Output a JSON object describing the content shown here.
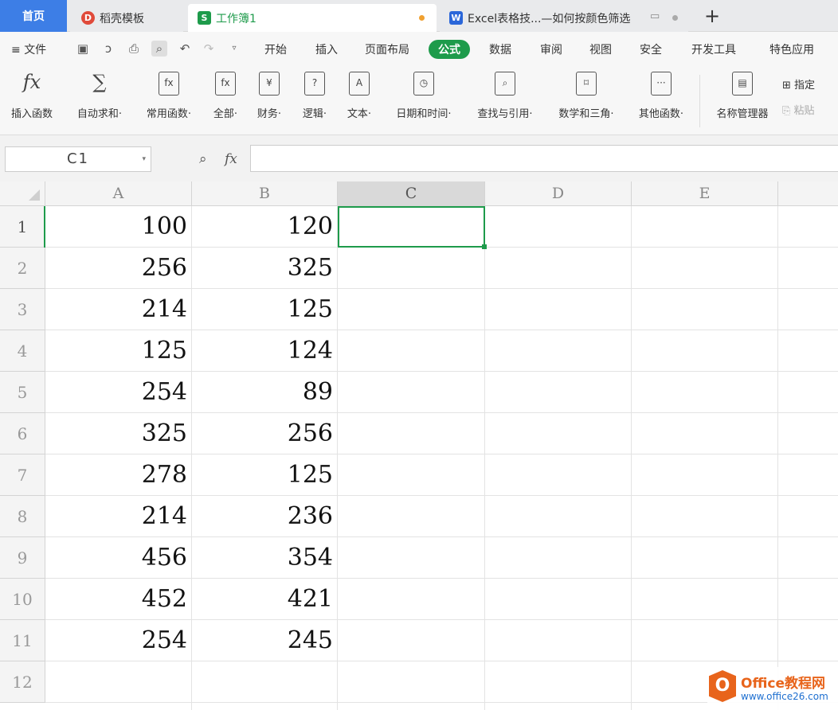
{
  "tabs": [
    {
      "label": "首页"
    },
    {
      "label": "稻壳模板"
    },
    {
      "label": "工作簿1"
    },
    {
      "label": "Excel表格技...—如何按颜色筛选"
    }
  ],
  "quick_icons": [
    "save-icon",
    "format-painter-icon",
    "print-icon",
    "print-preview-icon",
    "undo-icon",
    "redo-icon",
    "customize-arrow-icon"
  ],
  "menu": {
    "file": "文件",
    "items": [
      "开始",
      "插入",
      "页面布局",
      "公式",
      "数据",
      "审阅",
      "视图",
      "安全",
      "开发工具",
      "特色应用"
    ],
    "active": "公式"
  },
  "ribbon": {
    "buttons": [
      {
        "label": "插入函数",
        "glyph": "fx"
      },
      {
        "label": "自动求和·",
        "glyph": "∑"
      },
      {
        "label": "常用函数·",
        "glyph": "fx"
      },
      {
        "label": "全部·",
        "glyph": "fx"
      },
      {
        "label": "财务·",
        "glyph": "¥"
      },
      {
        "label": "逻辑·",
        "glyph": "?"
      },
      {
        "label": "文本·",
        "glyph": "A"
      },
      {
        "label": "日期和时间·",
        "glyph": "◷"
      },
      {
        "label": "查找与引用·",
        "glyph": "⌕"
      },
      {
        "label": "数学和三角·",
        "glyph": "⌑"
      },
      {
        "label": "其他函数·",
        "glyph": "···"
      },
      {
        "label": "名称管理器",
        "glyph": "▤"
      }
    ],
    "side": {
      "pin": "指定",
      "paste": "粘贴"
    }
  },
  "formula_bar": {
    "name_box": "C1",
    "fx": "fx",
    "value": ""
  },
  "sheet": {
    "columns": [
      "A",
      "B",
      "C",
      "D",
      "E"
    ],
    "selected_column": "C",
    "rows": [
      "1",
      "2",
      "3",
      "4",
      "5",
      "6",
      "7",
      "8",
      "9",
      "10",
      "11",
      "12"
    ],
    "data": [
      [
        "100",
        "120"
      ],
      [
        "256",
        "325"
      ],
      [
        "214",
        "125"
      ],
      [
        "125",
        "124"
      ],
      [
        "254",
        "89"
      ],
      [
        "325",
        "256"
      ],
      [
        "278",
        "125"
      ],
      [
        "214",
        "236"
      ],
      [
        "456",
        "354"
      ],
      [
        "452",
        "421"
      ],
      [
        "254",
        "245"
      ]
    ],
    "selected_cell": "C1"
  },
  "colors": {
    "accent": "#1e9b4b",
    "home_tab": "#3d7ee6",
    "watermark": "#e8641b"
  },
  "watermark": {
    "title": "Office教程网",
    "url": "www.office26.com"
  }
}
